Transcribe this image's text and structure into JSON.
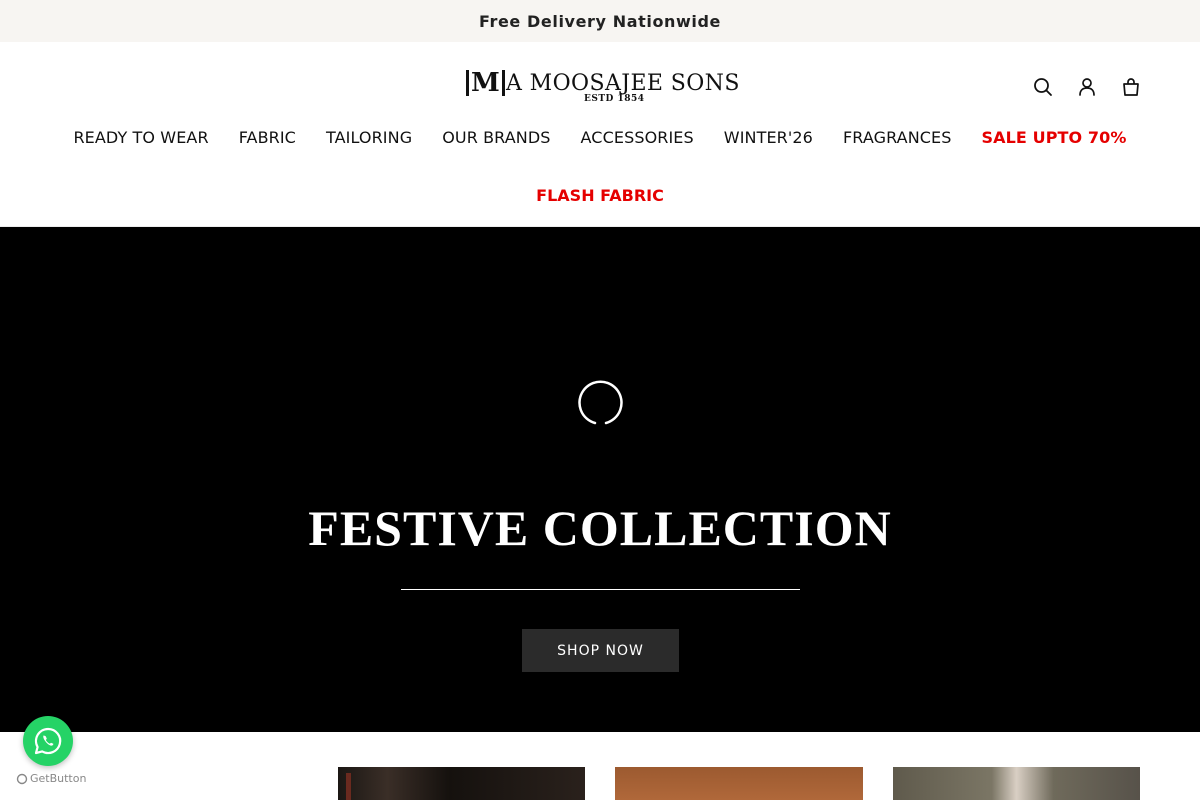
{
  "announcement": {
    "text": "Free Delivery Nationwide"
  },
  "header": {
    "logo": {
      "mark": "M",
      "name": "A MOOSAJEE SONS",
      "estd": "ESTD 1854"
    },
    "icons": [
      "search-icon",
      "account-icon",
      "cart-icon"
    ]
  },
  "nav": {
    "items": [
      {
        "label": "READY TO WEAR"
      },
      {
        "label": "FABRIC"
      },
      {
        "label": "TAILORING"
      },
      {
        "label": "OUR BRANDS"
      },
      {
        "label": "ACCESSORIES"
      },
      {
        "label": "WINTER'26"
      },
      {
        "label": "FRAGRANCES"
      },
      {
        "label": "SALE UPTO 70%"
      },
      {
        "label": "FLASH FABRIC"
      }
    ],
    "highlight_color": "#e50000"
  },
  "hero": {
    "title": "FESTIVE COLLECTION",
    "button_label": "SHOP NOW",
    "background": "#000000"
  },
  "widgets": {
    "whatsapp_icon": "whatsapp-icon",
    "getbutton_label": "GetButton"
  }
}
